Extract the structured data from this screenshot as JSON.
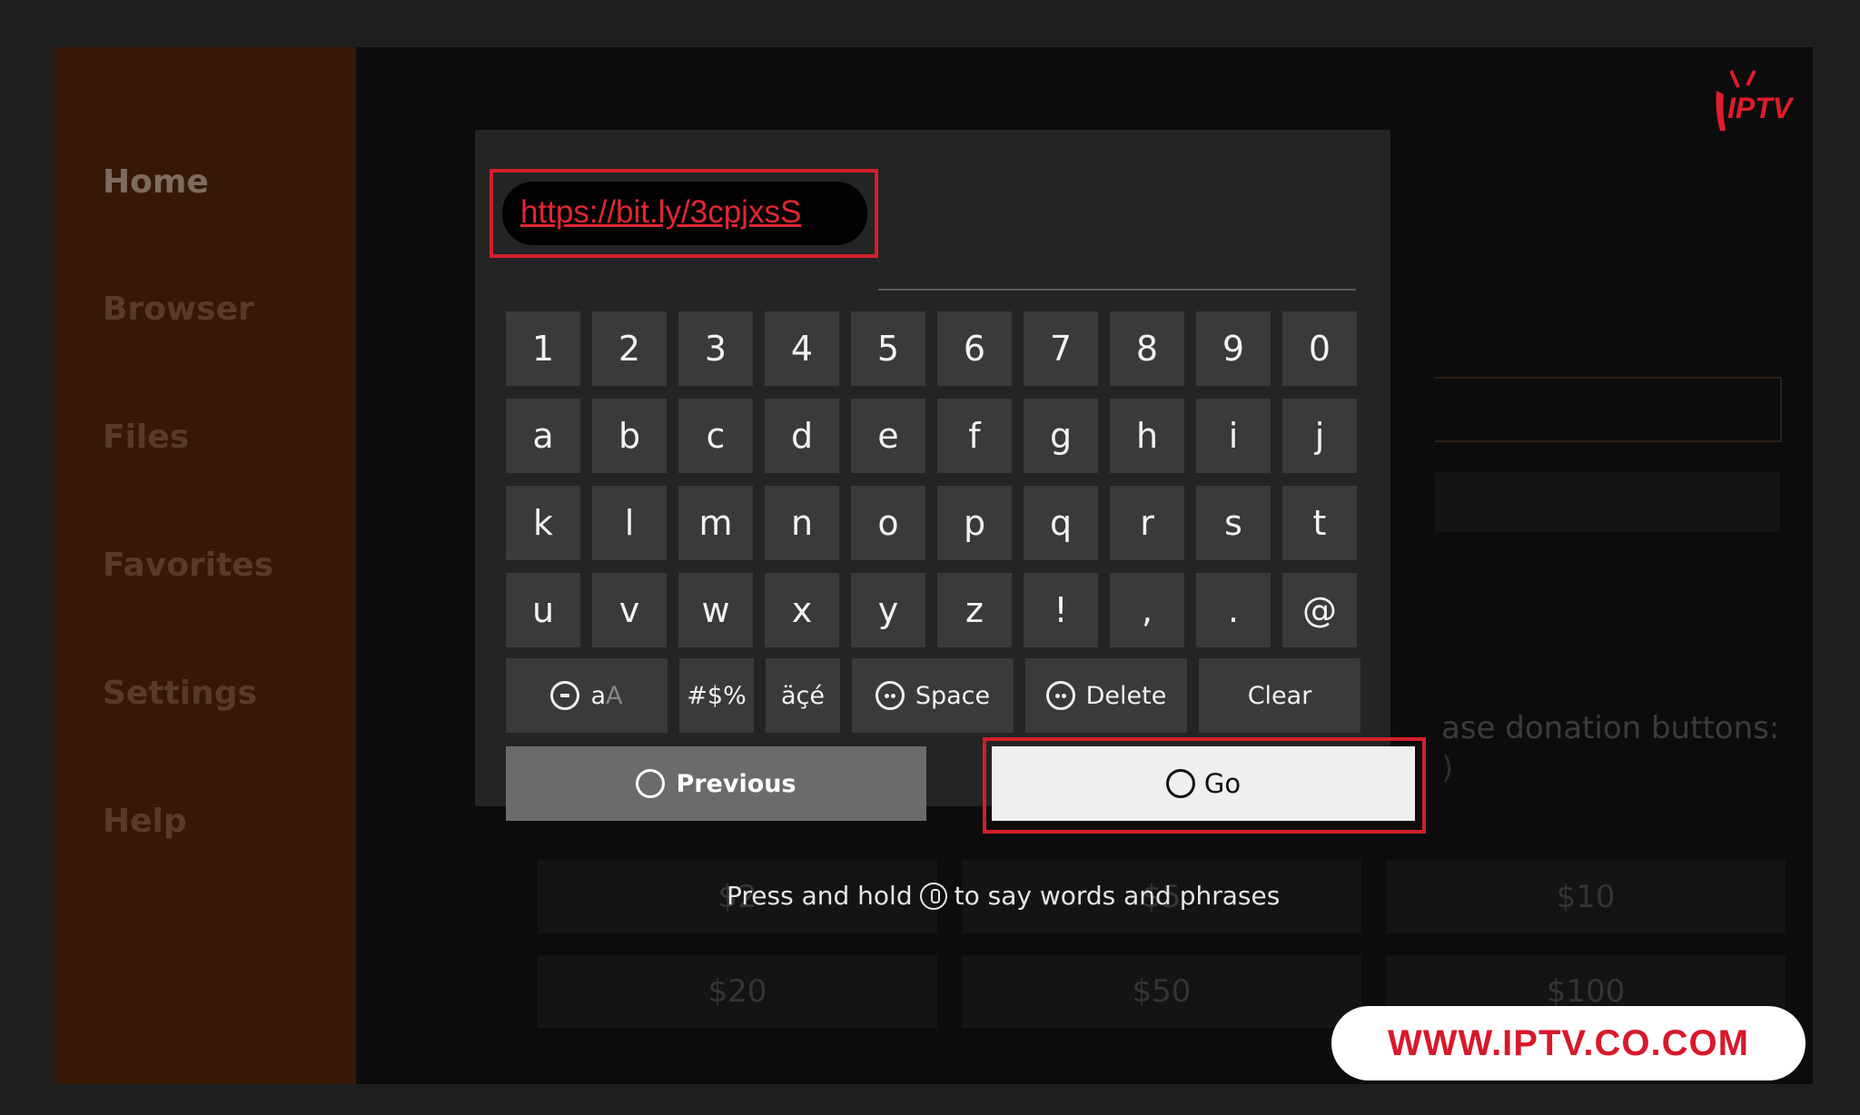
{
  "sidebar": {
    "items": [
      {
        "label": "Home"
      },
      {
        "label": "Browser"
      },
      {
        "label": "Files"
      },
      {
        "label": "Favorites"
      },
      {
        "label": "Settings"
      },
      {
        "label": "Help"
      }
    ]
  },
  "logo": {
    "text": "IPTV",
    "color": "#e01c2a"
  },
  "background": {
    "donation_text": "ase donation buttons:",
    "donation_text2": ")",
    "amounts": [
      "$2",
      "$5",
      "$10",
      "$20",
      "$50",
      "$100"
    ]
  },
  "keyboard": {
    "url_value": "https://bit.ly/3cpjxsS",
    "rows": [
      [
        "1",
        "2",
        "3",
        "4",
        "5",
        "6",
        "7",
        "8",
        "9",
        "0"
      ],
      [
        "a",
        "b",
        "c",
        "d",
        "e",
        "f",
        "g",
        "h",
        "i",
        "j"
      ],
      [
        "k",
        "l",
        "m",
        "n",
        "o",
        "p",
        "q",
        "r",
        "s",
        "t"
      ],
      [
        "u",
        "v",
        "w",
        "x",
        "y",
        "z",
        "!",
        ",",
        ".",
        "@"
      ]
    ],
    "function_keys": {
      "case_label": "a",
      "case_alt": "A",
      "symbols": "#$%",
      "accents": "äçé",
      "space": "Space",
      "delete": "Delete",
      "clear": "Clear"
    },
    "previous_label": "Previous",
    "go_label": "Go"
  },
  "hint": {
    "before": "Press and hold",
    "after": "to say words and phrases"
  },
  "banner": {
    "text": "WWW.IPTV.CO.COM"
  },
  "colors": {
    "highlight_red": "#d21f2b",
    "key_bg": "#3a3a3a",
    "panel_bg": "#242424"
  }
}
